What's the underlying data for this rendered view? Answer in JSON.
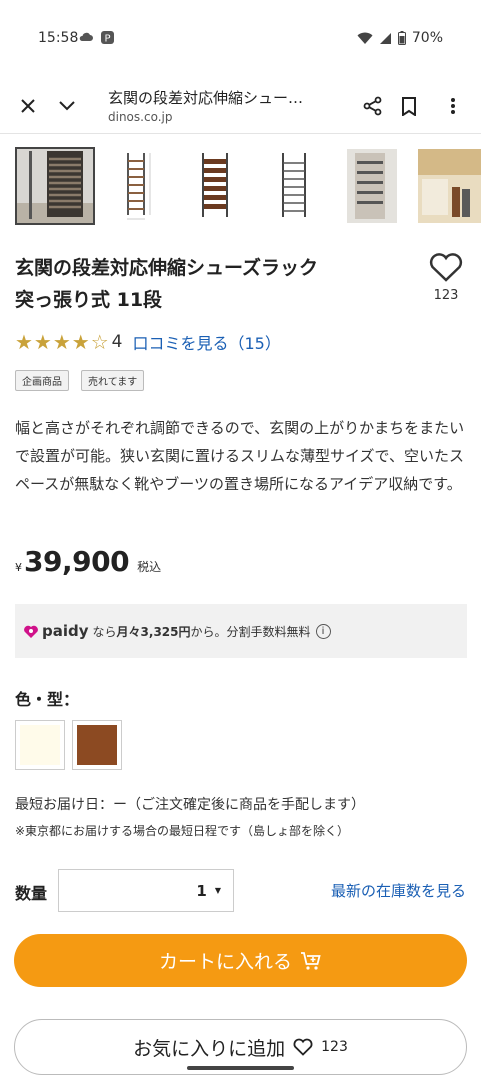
{
  "status_bar": {
    "time": "15:58",
    "battery": "70%"
  },
  "topbar": {
    "page_title": "玄関の段差対応伸縮シュー…",
    "domain": "dinos.co.jp"
  },
  "thumbnails": [
    {
      "name": "thumb-1"
    },
    {
      "name": "thumb-2"
    },
    {
      "name": "thumb-3"
    },
    {
      "name": "thumb-4"
    },
    {
      "name": "thumb-5"
    },
    {
      "name": "thumb-6"
    }
  ],
  "product": {
    "title_line1": "玄関の段差対応伸縮シューズラック",
    "title_line2": "突っ張り式 11段",
    "favorite_count": "123",
    "rating_stars": "★★★★☆",
    "rating_value": "4",
    "rating_numeric": 4,
    "review_link": "口コミを見る（15）",
    "badges": [
      "企画商品",
      "売れてます"
    ],
    "description": "幅と高さがそれぞれ調節できるので、玄関の上がりかまちをまたいで設置が可能。狭い玄関に置けるスリムな薄型サイズで、空いたスペースが無駄なく靴やブーツの置き場所になるアイデア収納です。",
    "price_currency": "¥",
    "price": "39,900",
    "price_tax": "税込"
  },
  "paidy": {
    "logo": "paidy",
    "text_prefix": "なら",
    "text_amount": "月々3,325円",
    "text_suffix": "から。分割手数料無料",
    "info_icon": "i"
  },
  "options": {
    "color_label": "色・型：",
    "swatches": [
      {
        "name": "white",
        "color": "#fffbea"
      },
      {
        "name": "brown",
        "color": "#8c4a22"
      }
    ]
  },
  "delivery": {
    "text": "最短お届け日：ー（ご注文確定後に商品を手配します）",
    "note": "※東京都にお届けする場合の最短日程です（島しょ部を除く）"
  },
  "quantity": {
    "label": "数量",
    "value": "1",
    "stock_link": "最新の在庫数を見る"
  },
  "buttons": {
    "cart": "カートに入れる",
    "favorite": "お気に入りに追加",
    "favorite_count": "123"
  },
  "colors": {
    "accent": "#f59a12",
    "link": "#1a5fb4",
    "star": "#c9a23a"
  }
}
